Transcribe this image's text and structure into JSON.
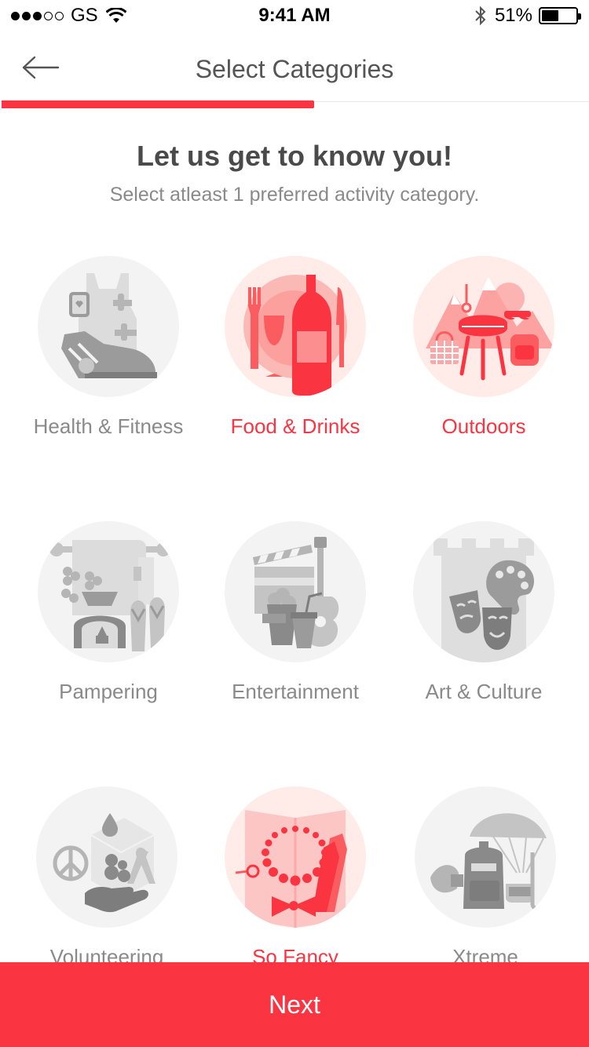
{
  "status_bar": {
    "carrier": "GS",
    "time": "9:41 AM",
    "battery_percent": "51%",
    "battery_level": 0.51,
    "signal_bars_filled": 3,
    "signal_bars_total": 5
  },
  "nav": {
    "back_icon": "arrow-left-icon",
    "title": "Select Categories"
  },
  "progress": {
    "fraction": 0.53,
    "color": "#fb3441"
  },
  "intro": {
    "heading": "Let us get to know you!",
    "subheading": "Select atleast 1 preferred activity category."
  },
  "categories": [
    {
      "label": "Health & Fitness",
      "icon": "fitness-icon",
      "selected": false
    },
    {
      "label": "Food & Drinks",
      "icon": "food-drinks-icon",
      "selected": true
    },
    {
      "label": "Outdoors",
      "icon": "outdoors-icon",
      "selected": true
    },
    {
      "label": "Pampering",
      "icon": "pampering-icon",
      "selected": false
    },
    {
      "label": "Entertainment",
      "icon": "entertainment-icon",
      "selected": false
    },
    {
      "label": "Art & Culture",
      "icon": "art-culture-icon",
      "selected": false
    },
    {
      "label": "Volunteering",
      "icon": "volunteering-icon",
      "selected": false
    },
    {
      "label": "So Fancy",
      "icon": "so-fancy-icon",
      "selected": true
    },
    {
      "label": "Xtreme",
      "icon": "xtreme-icon",
      "selected": false
    }
  ],
  "colors": {
    "accent": "#fb3441",
    "icon_gray": "#c4c4c4",
    "icon_dark_gray": "#9b9b9b",
    "icon_red": "#fb3441",
    "icon_red_light": "#fba7a8"
  },
  "footer": {
    "next_label": "Next"
  }
}
